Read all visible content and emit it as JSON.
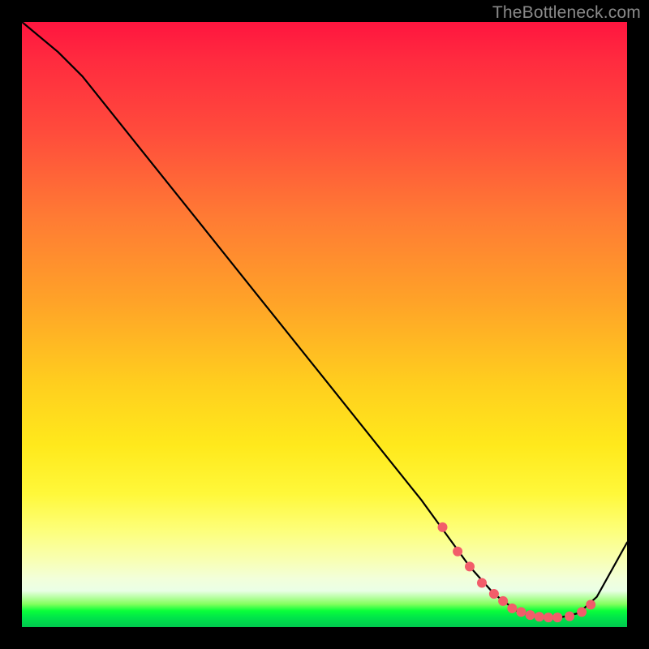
{
  "watermark": "TheBottleneck.com",
  "chart_data": {
    "type": "line",
    "title": "",
    "xlabel": "",
    "ylabel": "",
    "xlim": [
      0,
      100
    ],
    "ylim": [
      0,
      100
    ],
    "grid": false,
    "series": [
      {
        "name": "bottleneck-curve",
        "x": [
          0,
          6,
          10,
          20,
          30,
          40,
          50,
          60,
          66,
          70,
          74,
          78,
          82,
          86,
          89,
          92,
          95,
          100
        ],
        "y": [
          100,
          95,
          91,
          78.5,
          66,
          53.5,
          41,
          28.5,
          21,
          15.5,
          10,
          5.5,
          2.5,
          1.6,
          1.6,
          2.3,
          5,
          14
        ]
      }
    ],
    "markers": {
      "name": "highlight-points",
      "color": "#f25d6a",
      "radius": 6,
      "x": [
        69.5,
        72,
        74,
        76,
        78,
        79.5,
        81,
        82.5,
        84,
        85.5,
        87,
        88.5,
        90.5,
        92.5,
        94
      ],
      "y": [
        16.5,
        12.5,
        10,
        7.3,
        5.5,
        4.3,
        3.1,
        2.5,
        2.0,
        1.7,
        1.6,
        1.6,
        1.8,
        2.5,
        3.7
      ]
    },
    "background": {
      "gradient_stops": [
        {
          "pos": 0.0,
          "color": "#ff153f"
        },
        {
          "pos": 0.32,
          "color": "#ff7a34"
        },
        {
          "pos": 0.6,
          "color": "#ffcf1e"
        },
        {
          "pos": 0.84,
          "color": "#fdff7a"
        },
        {
          "pos": 0.94,
          "color": "#eaffe6"
        },
        {
          "pos": 0.97,
          "color": "#0aff3a"
        },
        {
          "pos": 1.0,
          "color": "#00c84e"
        }
      ]
    }
  }
}
